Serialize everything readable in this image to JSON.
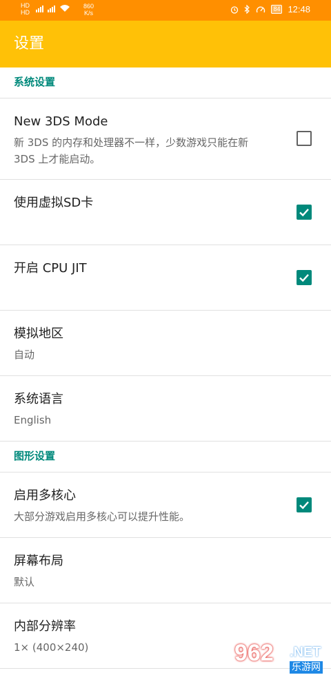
{
  "status_bar": {
    "network_labels": [
      "HD",
      "HD"
    ],
    "speed_value": "860",
    "speed_unit": "K/s",
    "battery": "84",
    "time": "12:48"
  },
  "toolbar": {
    "title": "设置"
  },
  "sections": [
    {
      "header": "系统设置",
      "items": [
        {
          "title": "New 3DS Mode",
          "summary": "新 3DS 的内存和处理器不一样，少数游戏只能在新 3DS 上才能启动。",
          "checkbox": false
        },
        {
          "title": "使用虚拟SD卡",
          "checkbox": true
        },
        {
          "title": "开启 CPU JIT",
          "checkbox": true
        },
        {
          "title": "模拟地区",
          "summary": "自动"
        },
        {
          "title": "系统语言",
          "summary": "English"
        }
      ]
    },
    {
      "header": "图形设置",
      "items": [
        {
          "title": "启用多核心",
          "summary": "大部分游戏启用多核心可以提升性能。",
          "checkbox": true
        },
        {
          "title": "屏幕布局",
          "summary": "默认"
        },
        {
          "title": "内部分辨率",
          "summary": "1× (400×240)"
        }
      ]
    }
  ],
  "watermark": {
    "logo": "962",
    "net": ".NET",
    "cn": "乐游网"
  },
  "colors": {
    "status_bar": "#ff8f00",
    "toolbar": "#ffc107",
    "accent": "#00897b"
  }
}
